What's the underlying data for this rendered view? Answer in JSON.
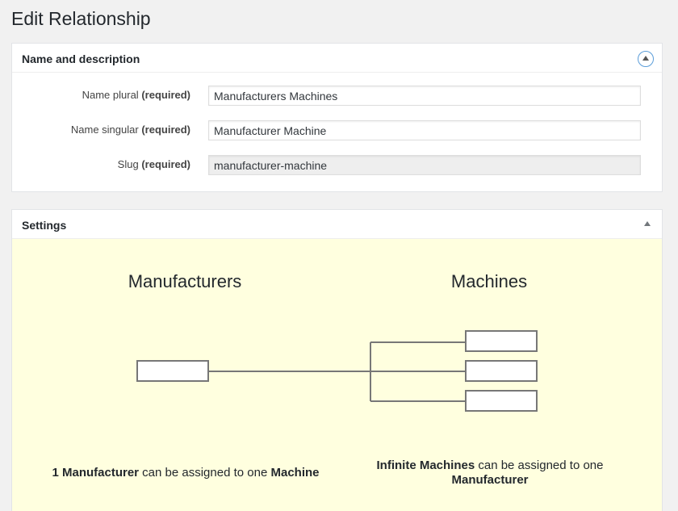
{
  "page": {
    "title": "Edit Relationship"
  },
  "name_box": {
    "title": "Name and description",
    "fields": [
      {
        "label": "Name plural",
        "required": "(required)",
        "value": "Manufacturers Machines",
        "readonly": false
      },
      {
        "label": "Name singular",
        "required": "(required)",
        "value": "Manufacturer Machine",
        "readonly": false
      },
      {
        "label": "Slug",
        "required": "(required)",
        "value": "manufacturer-machine",
        "readonly": true
      }
    ],
    "toggle_icon": "chevron-up-circle-icon"
  },
  "settings_box": {
    "title": "Settings",
    "toggle_icon": "arrow-up-icon",
    "left_heading": "Manufacturers",
    "right_heading": "Machines",
    "left_caption": {
      "bold1": "1 Manufacturer",
      "text": " can be assigned to one ",
      "bold2": "Machine"
    },
    "right_caption": {
      "bold1": "Infinite Machines",
      "text": " can be assigned to one ",
      "bold2": "Manufacturer"
    },
    "colors": {
      "background": "#ffffdf",
      "line": "#777777"
    }
  }
}
